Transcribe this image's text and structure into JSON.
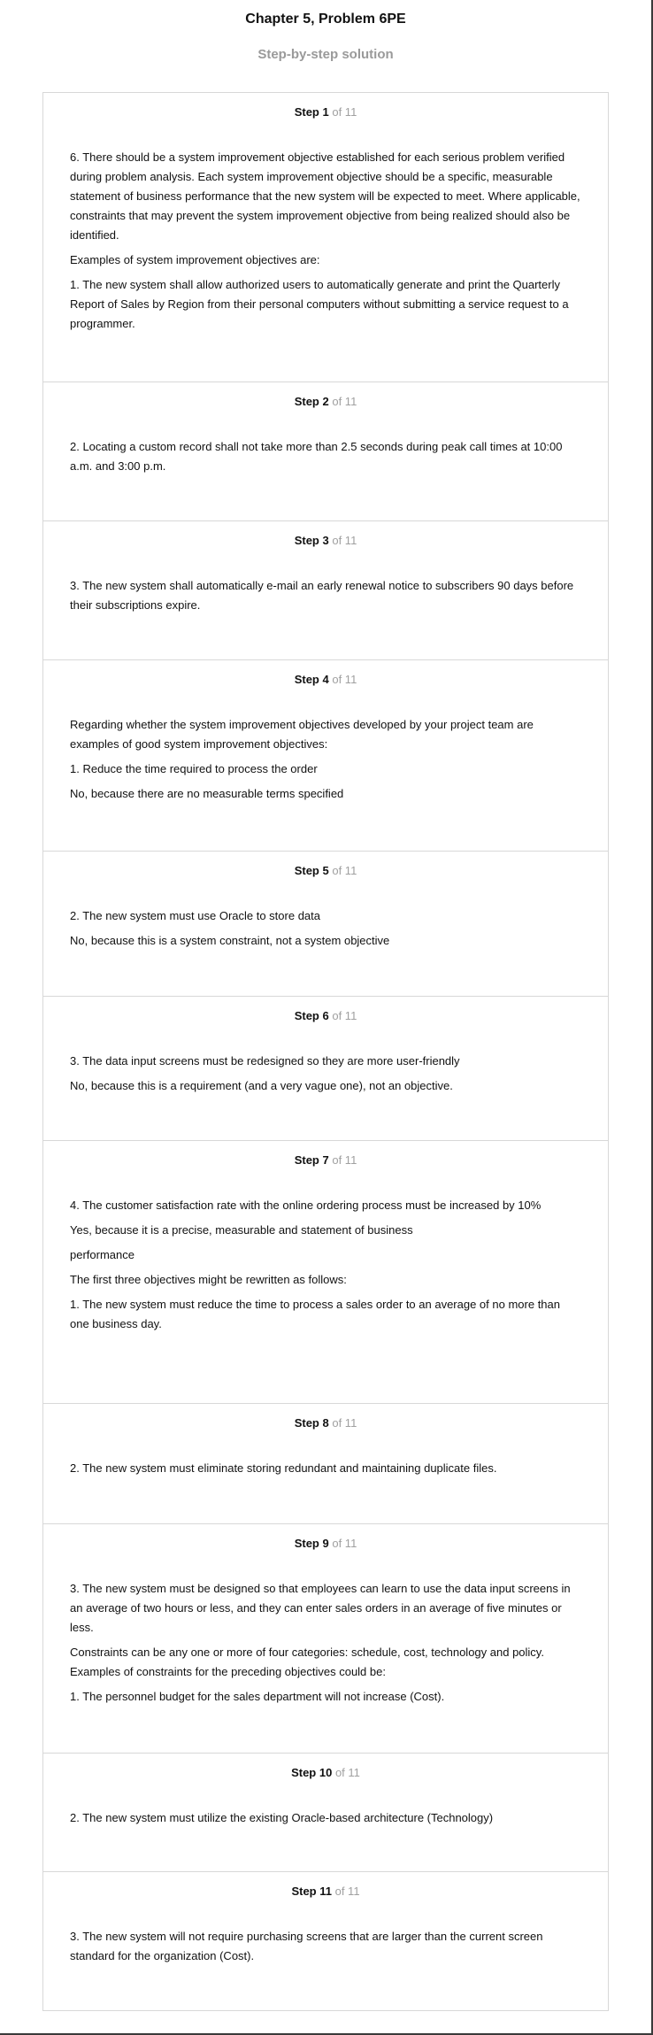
{
  "header": {
    "title": "Chapter 5, Problem 6PE",
    "subtitle": "Step-by-step solution"
  },
  "steps": [
    {
      "label": "Step 1",
      "of": "of 11",
      "paragraphs": [
        "6. There should be a system improvement objective established for each serious problem verified during problem analysis. Each system improvement objective should be a specific, measurable statement of business performance that the new system will be expected to meet. Where applicable, constraints that may prevent the system improvement objective from being realized should also be identified.",
        "Examples of system improvement objectives are:",
        "1. The new system shall allow authorized users to automatically generate and print the Quarterly Report of Sales by Region from their personal computers without submitting a service request to a programmer."
      ]
    },
    {
      "label": "Step 2",
      "of": "of 11",
      "paragraphs": [
        "2. Locating a custom record shall not take more than 2.5 seconds during peak call times at 10:00 a.m. and 3:00 p.m."
      ]
    },
    {
      "label": "Step 3",
      "of": "of 11",
      "paragraphs": [
        "3. The new system shall automatically e-mail an early renewal notice to subscribers 90 days before their subscriptions expire."
      ]
    },
    {
      "label": "Step 4",
      "of": "of 11",
      "paragraphs": [
        "Regarding whether the system improvement objectives developed by your project team are examples of good system improvement objectives:",
        "1. Reduce the time required to process the order",
        "No, because there are no measurable terms specified"
      ]
    },
    {
      "label": "Step 5",
      "of": "of 11",
      "paragraphs": [
        "2. The new system must use Oracle to store data",
        "No, because this is a system constraint, not a system objective"
      ]
    },
    {
      "label": "Step 6",
      "of": "of 11",
      "paragraphs": [
        "3. The data input screens must be redesigned so they are more user-friendly",
        "No, because this is a requirement (and a very vague one), not an objective."
      ]
    },
    {
      "label": "Step 7",
      "of": "of 11",
      "paragraphs": [
        "4. The customer satisfaction rate with the online ordering process must be increased by 10%",
        "Yes, because it is a precise, measurable and statement of business",
        "performance",
        "The first three objectives might be rewritten as follows:",
        "1. The new system must reduce the time to process a sales order to an average of no more than one business day."
      ]
    },
    {
      "label": "Step 8",
      "of": "of 11",
      "paragraphs": [
        "2. The new system must eliminate storing redundant and maintaining duplicate files."
      ]
    },
    {
      "label": "Step 9",
      "of": "of 11",
      "paragraphs": [
        "3. The new system must be designed so that employees can learn to use the data input screens in an average of two hours or less, and they can enter sales orders in an average of five minutes or less.",
        "Constraints can be any one or more of four categories: schedule, cost, technology and policy. Examples of constraints for the preceding objectives could be:",
        "1. The personnel budget for the sales department will not increase (Cost)."
      ]
    },
    {
      "label": "Step 10",
      "of": "of 11",
      "paragraphs": [
        "2. The new system must utilize the existing Oracle-based architecture (Technology)"
      ]
    },
    {
      "label": "Step 11",
      "of": "of 11",
      "paragraphs": [
        "3. The new system will not require purchasing screens that are larger than the current screen standard for the organization (Cost)."
      ]
    }
  ]
}
